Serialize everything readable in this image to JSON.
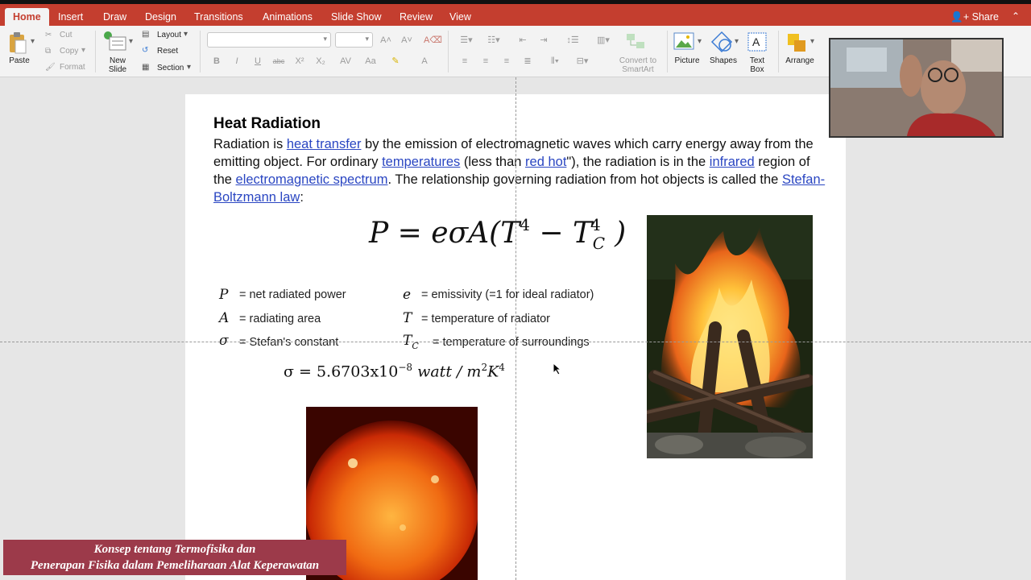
{
  "tabs": [
    {
      "label": "Home",
      "active": true
    },
    {
      "label": "Insert"
    },
    {
      "label": "Draw"
    },
    {
      "label": "Design"
    },
    {
      "label": "Transitions"
    },
    {
      "label": "Animations"
    },
    {
      "label": "Slide Show"
    },
    {
      "label": "Review"
    },
    {
      "label": "View"
    }
  ],
  "share_label": "Share",
  "ribbon": {
    "paste": "Paste",
    "cut": "Cut",
    "copy": "Copy",
    "format": "Format",
    "new_slide": "New\nSlide",
    "layout": "Layout",
    "reset": "Reset",
    "section": "Section",
    "convert": "Convert to\nSmartArt",
    "picture": "Picture",
    "shapes": "Shapes",
    "textbox": "Text\nBox",
    "arrange": "Arrange"
  },
  "slide": {
    "title": "Heat Radiation",
    "para": {
      "t1": "Radiation is ",
      "l1": "heat transfer",
      "t2": " by the emission of electromagnetic waves which carry energy away from the emitting object. For ordinary ",
      "l2": "temperatures",
      "t3": " (less than ",
      "l3": "red hot",
      "t4": "\"), the radiation is in the ",
      "l4": "infrared",
      "t5": " region of the ",
      "l5": "electromagnetic spectrum",
      "t6": ". The relationship governing radiation from hot objects is called the ",
      "l6": "Stefan-Boltzmann law",
      "t7": ":"
    },
    "definitions": [
      {
        "sym": "P",
        "text": "= net radiated power"
      },
      {
        "sym": "e",
        "text": "= emissivity (=1 for ideal radiator)"
      },
      {
        "sym": "A",
        "text": "= radiating area"
      },
      {
        "sym": "T",
        "text": "= temperature of radiator"
      },
      {
        "sym": "σ",
        "text": "= Stefan's constant"
      },
      {
        "sym": "T",
        "sub": "C",
        "text": "= temperature of surroundings"
      }
    ],
    "sigma": {
      "lhs": "σ = 5.6703x10",
      "exp": "−8",
      "unit": "watt / m",
      "unit_exp": "2",
      "k": "K",
      "k_exp": "4"
    }
  },
  "caption": {
    "line1": "Konsep tentang Termofisika dan",
    "line2": "Penerapan Fisika dalam Pemeliharaan Alat Keperawatan"
  },
  "colors": {
    "tab_bar": "#c43e2f",
    "link": "#2a46c2",
    "caption_bg": "#9c3a4a"
  }
}
